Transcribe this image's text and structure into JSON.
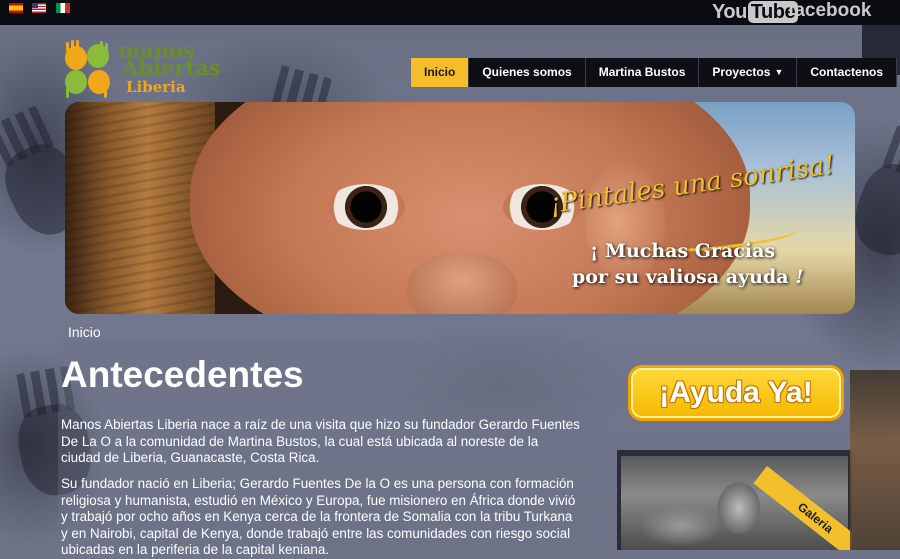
{
  "topbar": {
    "flags": [
      "spain-flag-icon",
      "usa-flag-icon",
      "italy-flag-icon"
    ],
    "youtube_you": "You",
    "youtube_tube": "Tube",
    "facebook": "facebook"
  },
  "logo": {
    "line1": "manos",
    "line2": "Abiertas",
    "line3": "Liberia"
  },
  "nav": {
    "items": [
      {
        "label": "Inicio",
        "active": true
      },
      {
        "label": "Quienes somos"
      },
      {
        "label": "Martina Bustos"
      },
      {
        "label": "Proyectos",
        "dropdown": true
      },
      {
        "label": "Contactenos"
      }
    ]
  },
  "banner": {
    "slogan": "¡Pintales una sonrisa!",
    "thanks_line1": "¡ Muchas Gracias",
    "thanks_line2": "por su valiosa ayuda",
    "thanks_excl": "!"
  },
  "breadcrumb": "Inicio",
  "main": {
    "title": "Antecedentes",
    "paragraph1": "Manos Abiertas Liberia nace a raíz de una visita que hizo su fundador Gerardo Fuentes De La O a la comunidad de Martina Bustos, la cual está ubicada al noreste de la ciudad de Liberia, Guanacaste, Costa Rica.",
    "paragraph2": "Su fundador nació en Liberia; Gerardo Fuentes De la O es una persona con formación religiosa y humanista, estudió en México y Europa, fue misionero en África donde vivió y trabajó por ocho años en Kenya cerca de la frontera de Somalia con la tribu Turkana y en Nairobi, capital de Kenya, donde trabajó entre las comunidades con riesgo social ubicadas en la periferia de la capital keniana."
  },
  "sidebar": {
    "donate_label": "¡Ayuda Ya!",
    "gallery_label": "Galeria"
  },
  "colors": {
    "accent": "#f5bd2a",
    "nav_bg": "#0d0f15",
    "page_bg": "#6f7489"
  }
}
